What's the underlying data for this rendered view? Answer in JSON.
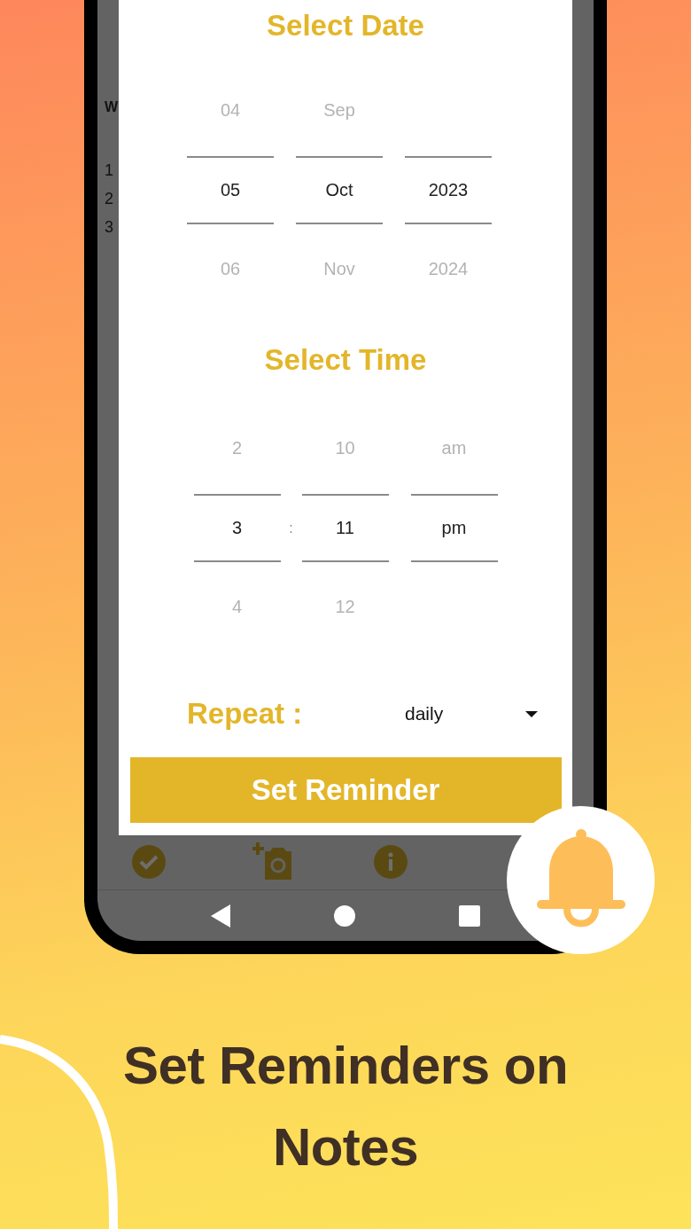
{
  "background_note": {
    "title": "W",
    "lines": [
      "1",
      "2",
      "3"
    ]
  },
  "dialog": {
    "date_title": "Select Date",
    "date_columns": [
      {
        "above": "04",
        "value": "05",
        "below": "06"
      },
      {
        "above": "Sep",
        "value": "Oct",
        "below": "Nov"
      },
      {
        "value": "2023",
        "below": "2024"
      }
    ],
    "time_title": "Select Time",
    "time_columns": [
      {
        "above": "2",
        "value": "3",
        "below": "4"
      },
      {
        "above": "10",
        "value": "11",
        "below": "12"
      },
      {
        "above": "am",
        "value": "pm"
      }
    ],
    "time_separator": ":",
    "repeat": {
      "label": "Repeat :",
      "value": "daily"
    },
    "button": "Set Reminder"
  },
  "headline": "Set Reminders on Notes"
}
